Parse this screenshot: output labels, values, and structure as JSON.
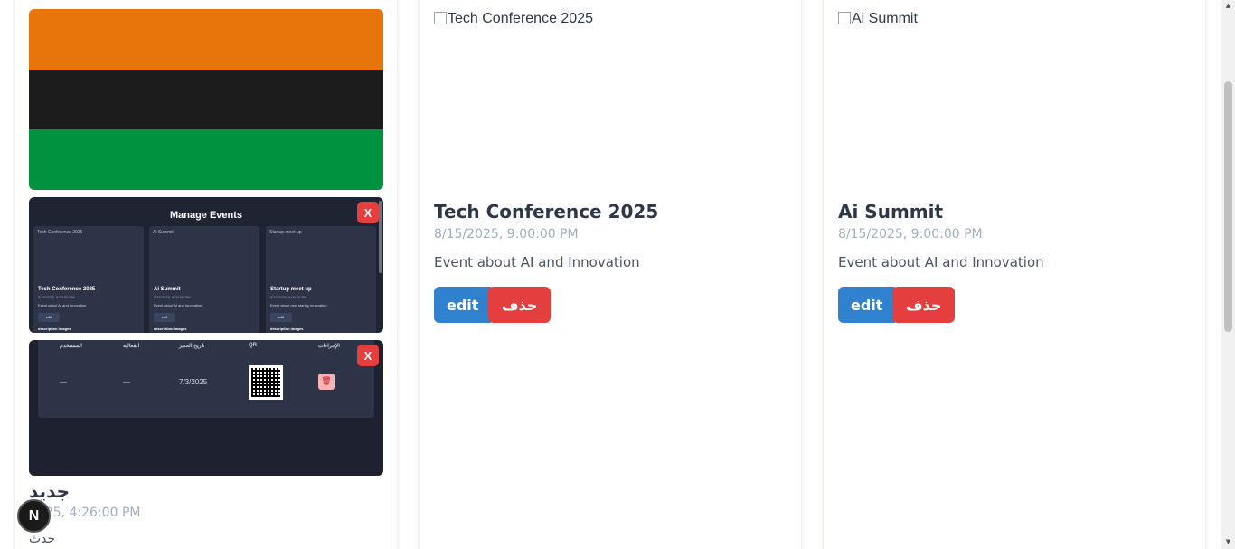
{
  "new_event": {
    "title": "جديد",
    "date": "2025, 4:26:00 PM",
    "description": "حدث",
    "close_label": "X",
    "close_label_2": "X"
  },
  "mini_manage": {
    "title": "Manage Events",
    "cards": [
      {
        "img_alt": "Tech Conference 2025",
        "name": "Tech Conference 2025",
        "date": "8/15/2025, 9:00:00 PM",
        "desc": "Event about AI and Innovation",
        "edit": "edit",
        "foot": "description images"
      },
      {
        "img_alt": "Ai Summit",
        "name": "Ai Summit",
        "date": "8/15/2025, 9:00:00 PM",
        "desc": "Event about AI and Innovation",
        "edit": "edit",
        "foot": "description images"
      },
      {
        "img_alt": "Startup meet up",
        "name": "Startup meet up",
        "date": "8/15/2025, 9:00:00 PM",
        "desc": "Event about new startup innovation",
        "edit": "edit",
        "foot": "description images"
      }
    ]
  },
  "mini_table": {
    "headers": [
      "المستخدم",
      "الفعالية",
      "تاريخ الحجز",
      "QR",
      "الإجراءات"
    ],
    "row": {
      "user": "—",
      "event": "—",
      "date": "7/3/2025"
    }
  },
  "events": [
    {
      "img_alt": "Tech Conference 2025",
      "title": "Tech Conference 2025",
      "date": "8/15/2025, 9:00:00 PM",
      "description": "Event about AI and Innovation",
      "edit": "edit",
      "delete": "حذف"
    },
    {
      "img_alt": "Ai Summit",
      "title": "Ai Summit",
      "date": "8/15/2025, 9:00:00 PM",
      "description": "Event about AI and Innovation",
      "edit": "edit",
      "delete": "حذف"
    }
  ],
  "badge": "N",
  "colors": {
    "flag_top": "#e8740c",
    "flag_mid": "#1c1c1c",
    "flag_bottom": "#00923f",
    "primary": "#3182ce",
    "danger": "#e53e3e"
  }
}
